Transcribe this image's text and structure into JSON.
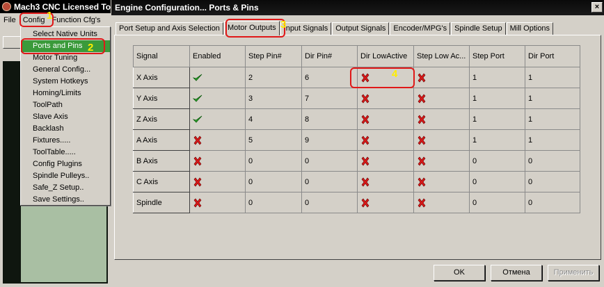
{
  "mach3": {
    "title": "Mach3 CNC  Licensed To:",
    "menu": [
      "File",
      "Config",
      "Function Cfg's"
    ]
  },
  "config_menu": {
    "items": [
      "Select Native Units",
      "Ports and Pins",
      "Motor Tuning",
      "General Config...",
      "System Hotkeys",
      "Homing/Limits",
      "ToolPath",
      "Slave Axis",
      "Backlash",
      "Fixtures.....",
      "ToolTable.....",
      "Config Plugins",
      "Spindle Pulleys..",
      "Safe_Z Setup..",
      "Save Settings.."
    ],
    "selected": "Ports and Pins"
  },
  "dialog": {
    "title": "Engine Configuration... Ports & Pins",
    "close_glyph": "×",
    "tabs": [
      "Port Setup and Axis Selection",
      "Motor Outputs",
      "Input Signals",
      "Output Signals",
      "Encoder/MPG's",
      "Spindle Setup",
      "Mill Options"
    ],
    "active_tab": "Motor Outputs",
    "columns": [
      "Signal",
      "Enabled",
      "Step Pin#",
      "Dir Pin#",
      "Dir LowActive",
      "Step Low Ac...",
      "Step Port",
      "Dir Port"
    ],
    "rows": [
      {
        "signal": "X Axis",
        "enabled": "check",
        "step_pin": "2",
        "dir_pin": "6",
        "dir_low": "cross",
        "step_low": "cross",
        "step_port": "1",
        "dir_port": "1"
      },
      {
        "signal": "Y Axis",
        "enabled": "check",
        "step_pin": "3",
        "dir_pin": "7",
        "dir_low": "cross",
        "step_low": "cross",
        "step_port": "1",
        "dir_port": "1"
      },
      {
        "signal": "Z Axis",
        "enabled": "check",
        "step_pin": "4",
        "dir_pin": "8",
        "dir_low": "cross",
        "step_low": "cross",
        "step_port": "1",
        "dir_port": "1"
      },
      {
        "signal": "A Axis",
        "enabled": "cross",
        "step_pin": "5",
        "dir_pin": "9",
        "dir_low": "cross",
        "step_low": "cross",
        "step_port": "1",
        "dir_port": "1"
      },
      {
        "signal": "B Axis",
        "enabled": "cross",
        "step_pin": "0",
        "dir_pin": "0",
        "dir_low": "cross",
        "step_low": "cross",
        "step_port": "0",
        "dir_port": "0"
      },
      {
        "signal": "C Axis",
        "enabled": "cross",
        "step_pin": "0",
        "dir_pin": "0",
        "dir_low": "cross",
        "step_low": "cross",
        "step_port": "0",
        "dir_port": "0"
      },
      {
        "signal": "Spindle",
        "enabled": "cross",
        "step_pin": "0",
        "dir_pin": "0",
        "dir_low": "cross",
        "step_low": "cross",
        "step_port": "0",
        "dir_port": "0"
      }
    ],
    "buttons": {
      "ok": "OK",
      "cancel": "Отмена",
      "apply": "Применить"
    }
  },
  "annotations": [
    "1",
    "2",
    "3",
    "4"
  ],
  "colors": {
    "highlight": "#3a9a3a",
    "annotation_box": "#e01818",
    "annotation_number": "#ffee00",
    "check": "#2faa2f",
    "cross": "#d81818"
  }
}
